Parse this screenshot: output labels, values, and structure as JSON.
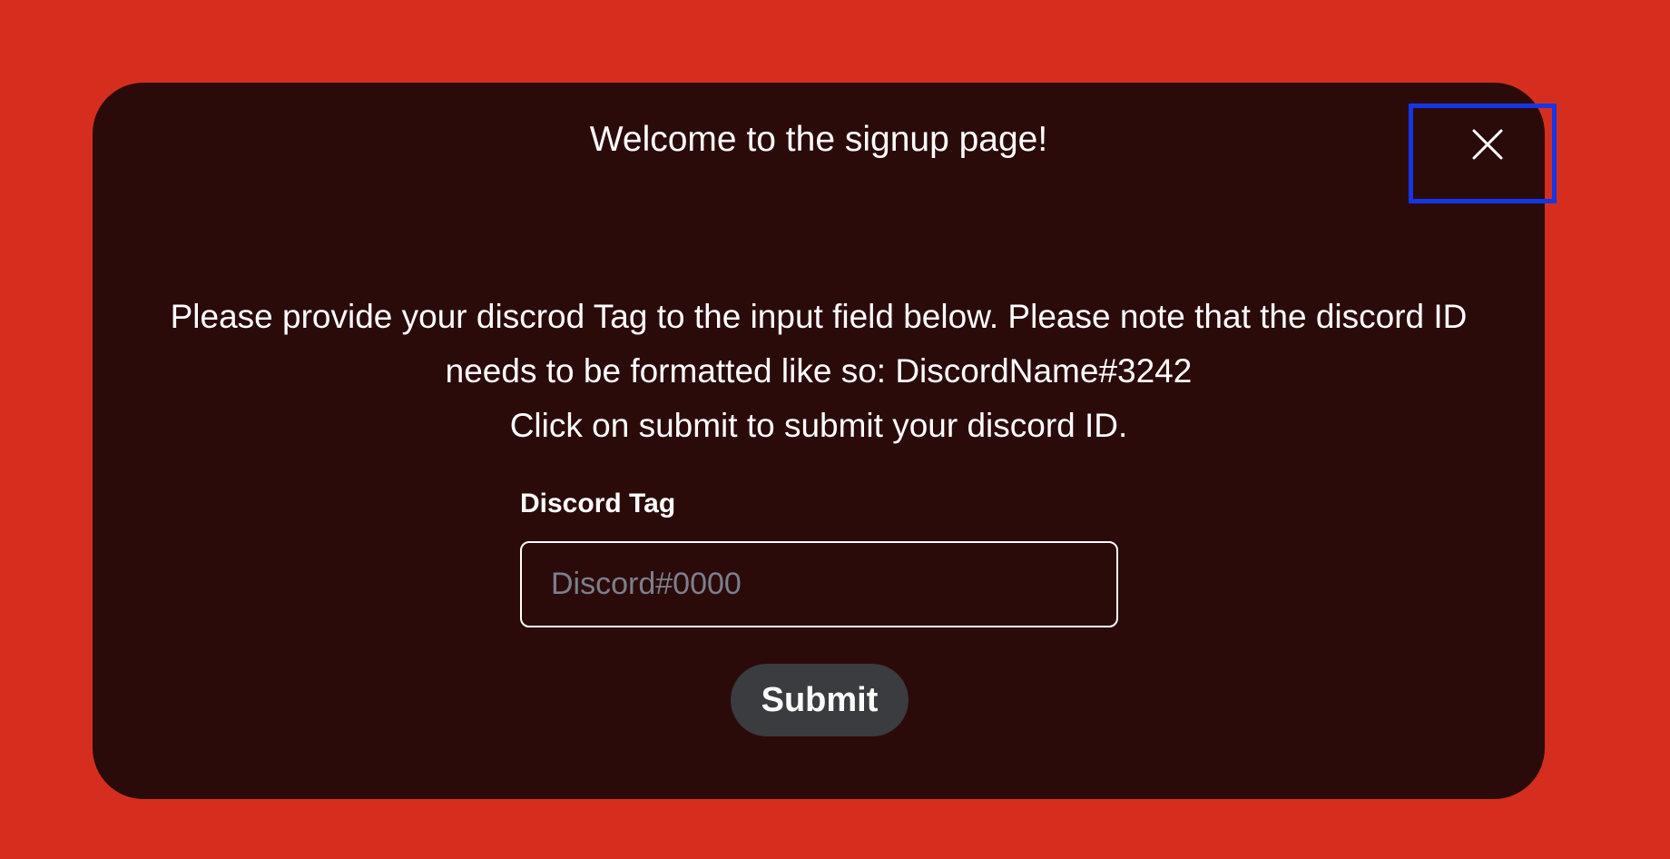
{
  "modal": {
    "title": "Welcome to the signup page!",
    "close_icon": "close-icon",
    "instructions": [
      "Please provide your discrod Tag to the input field below. Please note that the discord ID",
      "needs to be formatted like so: DiscordName#3242",
      "Click on submit to submit your discord ID."
    ],
    "form": {
      "label": "Discord Tag",
      "input_value": "",
      "input_placeholder": "Discord#0000",
      "submit_label": "Submit"
    }
  },
  "colors": {
    "page_background": "#d52e1f",
    "modal_background": "#2b0b0a",
    "highlight_border": "#1536e6",
    "button_background": "#3a3c3f",
    "placeholder": "#7c7f8c"
  }
}
